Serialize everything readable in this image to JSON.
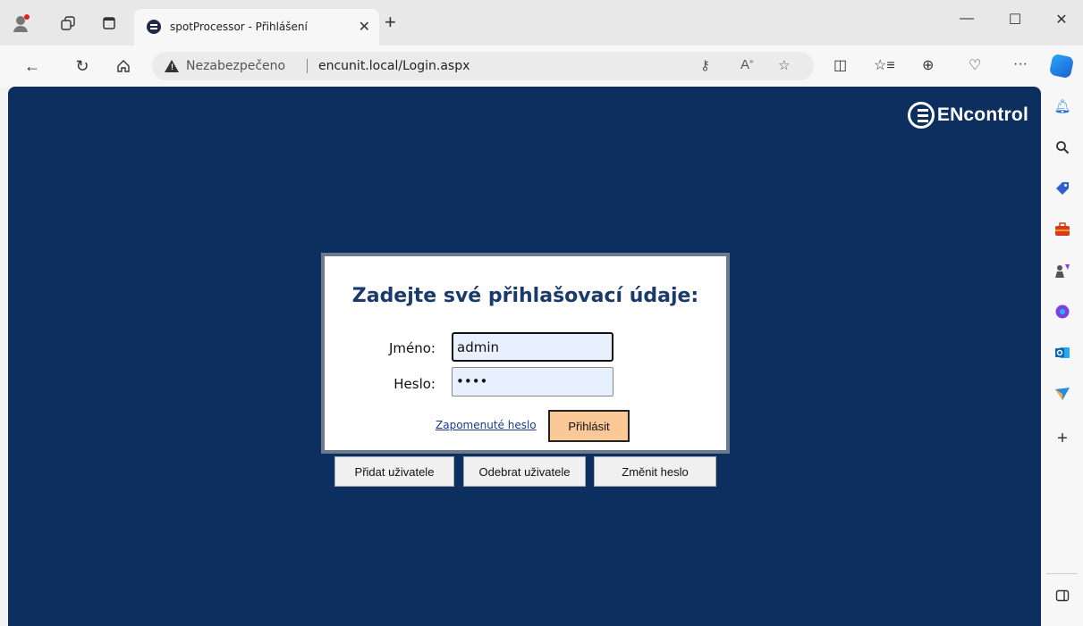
{
  "browser": {
    "tab_title": "spotProcessor - Přihlášení",
    "security_label": "Nezabezpečeno",
    "url": "encunit.local/Login.aspx"
  },
  "page": {
    "brand": "ENcontrol",
    "login": {
      "title": "Zadejte své přihlašovací údaje:",
      "username_label": "Jméno:",
      "username_value": "admin",
      "password_label": "Heslo:",
      "password_value": "••••",
      "forgot_link": "Zapomenuté heslo",
      "submit_label": "Přihlásit"
    },
    "buttons": {
      "add_user": "Přidat uživatele",
      "remove_user": "Odebrat uživatele",
      "change_password": "Změnit heslo"
    }
  },
  "colors": {
    "page_background": "#0c2f5f",
    "submit_button": "#fbc898",
    "title_text": "#1a3a6b"
  }
}
